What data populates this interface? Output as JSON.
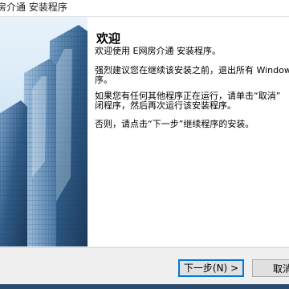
{
  "window": {
    "title": "房介通 安装程序"
  },
  "welcome": {
    "heading": "欢迎",
    "line1": "欢迎使用 E网房介通 安装程序。",
    "line2a": "强烈建议您在继续该安装之前，退出所有 Windows",
    "line2b": "序。",
    "line3a": "如果您有任何其他程序正在运行，请单击“取消”",
    "line3b": "闭程序，然后再次运行该安装程序。",
    "line4": "否则，请点击“下一步”继续程序的安装。"
  },
  "buttons": {
    "next_label": "下一步(N) >",
    "cancel_label": "取消"
  },
  "colors": {
    "focus_border": "#0078d7",
    "sky": "#cfe6f7",
    "building_glass": "#3f6e9a"
  },
  "icons": {
    "side_image": "building-skyscraper-image"
  }
}
